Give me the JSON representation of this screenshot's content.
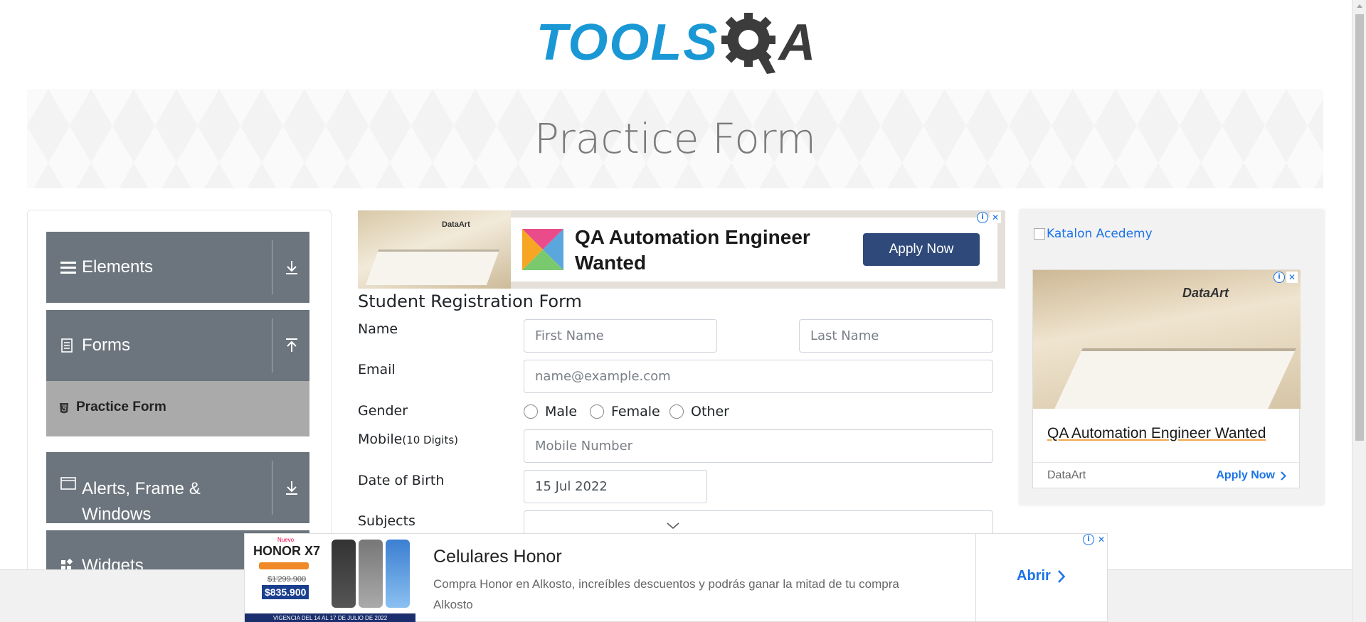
{
  "header": {
    "logo_tools": "TOOLS",
    "logo_qa": "A",
    "banner_title": "Practice Form"
  },
  "sidebar": {
    "groups": [
      {
        "label": "Elements",
        "icon": "hamburger-icon",
        "arrow": "download-arrow-icon"
      },
      {
        "label": "Forms",
        "icon": "document-icon",
        "arrow": "upload-arrow-icon"
      },
      {
        "label": "Alerts, Frame &",
        "label2": "Windows",
        "icon": "window-icon",
        "arrow": "download-arrow-icon"
      },
      {
        "label": "Widgets",
        "icon": "widgets-icon"
      }
    ],
    "active_item": {
      "label": "Practice Form",
      "icon": "html5-icon"
    }
  },
  "ad_top": {
    "brand": "DataArt",
    "headline": "QA Automation Engineer Wanted",
    "button": "Apply Now"
  },
  "form": {
    "title": "Student Registration Form",
    "name_label": "Name",
    "first_name_placeholder": "First Name",
    "last_name_placeholder": "Last Name",
    "email_label": "Email",
    "email_placeholder": "name@example.com",
    "gender_label": "Gender",
    "genders": [
      "Male",
      "Female",
      "Other"
    ],
    "mobile_label": "Mobile",
    "mobile_hint": "(10 Digits)",
    "mobile_placeholder": "Mobile Number",
    "dob_label": "Date of Birth",
    "dob_value": "15 Jul 2022",
    "subjects_label": "Subjects"
  },
  "ad_right": {
    "broken_image_alt": "Katalon Acedemy",
    "brand": "DataArt",
    "headline": "QA Automation Engineer Wanted",
    "advertiser": "DataArt",
    "cta": "Apply Now"
  },
  "ad_bottom": {
    "image_brand": "HONOR X7",
    "image_new": "Nuevo",
    "image_old_price": "$1'299.900",
    "image_price": "$835.900",
    "image_footer": "VIGENCIA DEL 14 AL 17 DE JULIO DE 2022",
    "title": "Celulares Honor",
    "description": "Compra Honor en Alkosto, increíbles descuentos y podrás ganar la mitad de tu compra",
    "advertiser": "Alkosto",
    "cta": "Abrir"
  },
  "colors": {
    "brand_blue": "#1a98d5",
    "sidebar_gray": "#6c757d",
    "active_gray": "#aaaaaa",
    "apply_button": "#2f4a7a",
    "link_blue": "#1a73e8"
  }
}
